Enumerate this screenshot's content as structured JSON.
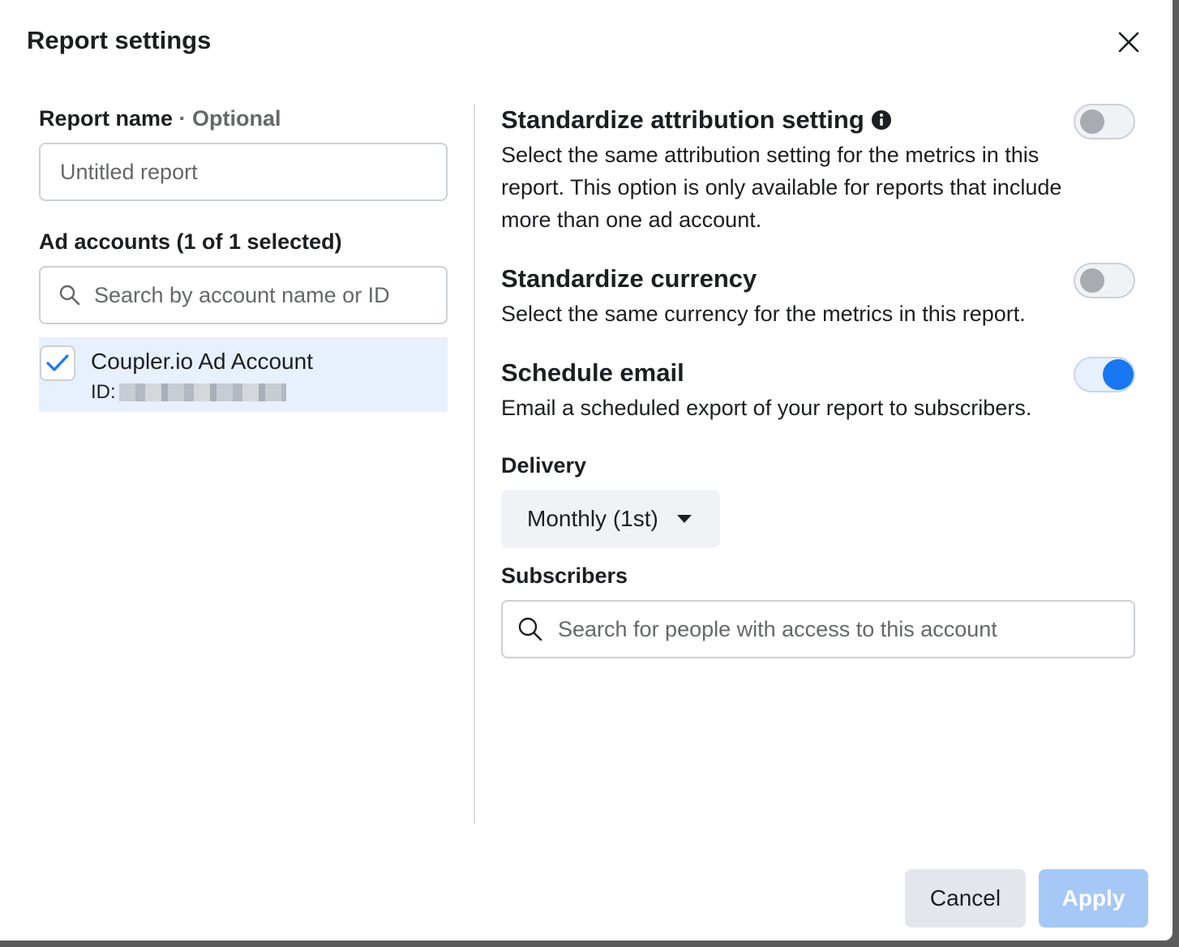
{
  "dialog": {
    "title": "Report settings"
  },
  "report_name": {
    "label": "Report name",
    "optional": " · Optional",
    "placeholder": "Untitled report",
    "value": ""
  },
  "ad_accounts": {
    "label": "Ad accounts (1 of 1 selected)",
    "search_placeholder": "Search by account name or ID",
    "items": [
      {
        "name": "Coupler.io Ad Account",
        "id_label": "ID:",
        "checked": true
      }
    ]
  },
  "attribution": {
    "title": "Standardize attribution setting",
    "description": "Select the same attribution setting for the metrics in this report. This option is only available for reports that include more than one ad account.",
    "enabled": false
  },
  "currency": {
    "title": "Standardize currency",
    "description": "Select the same currency for the metrics in this report.",
    "enabled": false
  },
  "schedule_email": {
    "title": "Schedule email",
    "description": "Email a scheduled export of your report to subscribers.",
    "enabled": true
  },
  "delivery": {
    "label": "Delivery",
    "selected": "Monthly (1st)"
  },
  "subscribers": {
    "label": "Subscribers",
    "search_placeholder": "Search for people with access to this account"
  },
  "footer": {
    "cancel_label": "Cancel",
    "apply_label": "Apply"
  },
  "colors": {
    "accent": "#1877f2",
    "selected_row": "#e7f0fd",
    "apply_disabled": "#a6c8f7"
  },
  "icons": [
    "close-icon",
    "info-icon",
    "search-icon",
    "check-icon",
    "caret-down-icon"
  ]
}
